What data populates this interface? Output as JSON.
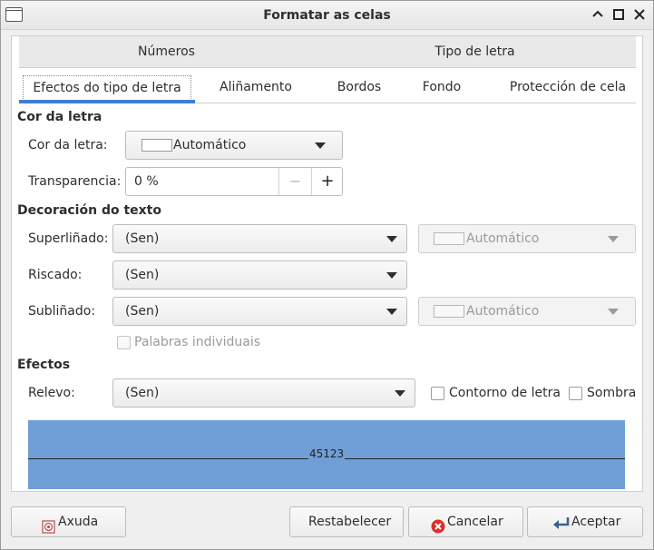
{
  "window": {
    "title": "Formatar as celas"
  },
  "tabs": {
    "top": [
      "Números",
      "Tipo de letra"
    ],
    "sub": [
      "Efectos do tipo de letra",
      "Aliñamento",
      "Bordos",
      "Fondo",
      "Protección de cela"
    ]
  },
  "font_color": {
    "section": "Cor da letra",
    "color_label": "Cor da letra:",
    "color_value": "Automático",
    "transparency_label": "Transparencia:",
    "transparency_value": "0 %",
    "minus": "−",
    "plus": "+"
  },
  "decoration": {
    "section": "Decoración do texto",
    "overline_label": "Superliñado:",
    "overline_value": "(Sen)",
    "overline_color": "Automático",
    "strike_label": "Riscado:",
    "strike_value": "(Sen)",
    "underline_label": "Subliñado:",
    "underline_value": "(Sen)",
    "underline_color": "Automático",
    "individual_words": "Palabras individuais"
  },
  "effects": {
    "section": "Efectos",
    "relief_label": "Relevo:",
    "relief_value": "(Sen)",
    "outline": "Contorno de letra",
    "shadow": "Sombra"
  },
  "preview": {
    "text": "45123"
  },
  "footer": {
    "help": "Axuda",
    "reset": "Restabelecer",
    "cancel": "Cancelar",
    "ok": "Aceptar"
  },
  "colors": {
    "accent": "#3d7fd1",
    "preview_bg": "#6f9fd6",
    "cancel_icon": "#d9302c"
  }
}
